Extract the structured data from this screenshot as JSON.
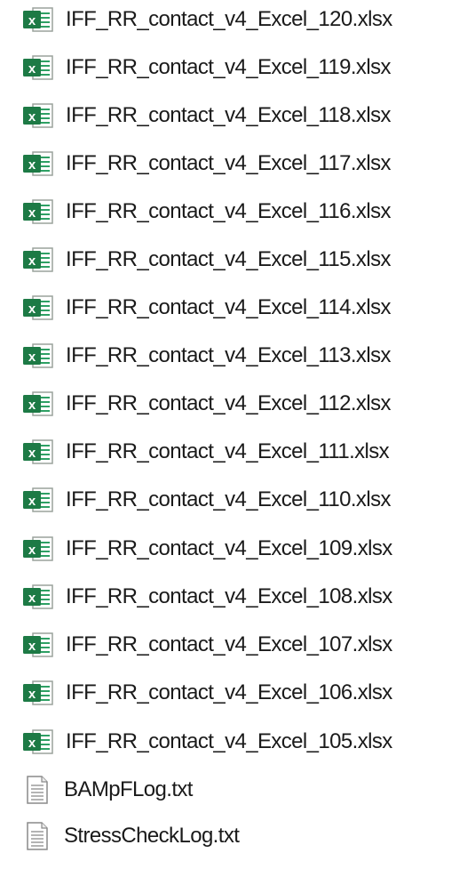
{
  "file_list": {
    "items": [
      {
        "name": "IFF_RR_contact_v4_Excel_120.xlsx",
        "icon": "excel-file-icon",
        "type": "excel"
      },
      {
        "name": "IFF_RR_contact_v4_Excel_119.xlsx",
        "icon": "excel-file-icon",
        "type": "excel"
      },
      {
        "name": "IFF_RR_contact_v4_Excel_118.xlsx",
        "icon": "excel-file-icon",
        "type": "excel"
      },
      {
        "name": "IFF_RR_contact_v4_Excel_117.xlsx",
        "icon": "excel-file-icon",
        "type": "excel"
      },
      {
        "name": "IFF_RR_contact_v4_Excel_116.xlsx",
        "icon": "excel-file-icon",
        "type": "excel"
      },
      {
        "name": "IFF_RR_contact_v4_Excel_115.xlsx",
        "icon": "excel-file-icon",
        "type": "excel"
      },
      {
        "name": "IFF_RR_contact_v4_Excel_114.xlsx",
        "icon": "excel-file-icon",
        "type": "excel"
      },
      {
        "name": "IFF_RR_contact_v4_Excel_113.xlsx",
        "icon": "excel-file-icon",
        "type": "excel"
      },
      {
        "name": "IFF_RR_contact_v4_Excel_112.xlsx",
        "icon": "excel-file-icon",
        "type": "excel"
      },
      {
        "name": "IFF_RR_contact_v4_Excel_111.xlsx",
        "icon": "excel-file-icon",
        "type": "excel"
      },
      {
        "name": "IFF_RR_contact_v4_Excel_110.xlsx",
        "icon": "excel-file-icon",
        "type": "excel"
      },
      {
        "name": "IFF_RR_contact_v4_Excel_109.xlsx",
        "icon": "excel-file-icon",
        "type": "excel"
      },
      {
        "name": "IFF_RR_contact_v4_Excel_108.xlsx",
        "icon": "excel-file-icon",
        "type": "excel"
      },
      {
        "name": "IFF_RR_contact_v4_Excel_107.xlsx",
        "icon": "excel-file-icon",
        "type": "excel"
      },
      {
        "name": "IFF_RR_contact_v4_Excel_106.xlsx",
        "icon": "excel-file-icon",
        "type": "excel"
      },
      {
        "name": "IFF_RR_contact_v4_Excel_105.xlsx",
        "icon": "excel-file-icon",
        "type": "excel"
      },
      {
        "name": "BAMpFLog.txt",
        "icon": "text-file-icon",
        "type": "text"
      },
      {
        "name": "StressCheckLog.txt",
        "icon": "text-file-icon",
        "type": "text"
      }
    ]
  },
  "colors": {
    "excel_green": "#1d7a45",
    "excel_green_light": "#2ea064",
    "text_color": "#1a1a1a",
    "doc_outline": "#8a8a8a"
  }
}
